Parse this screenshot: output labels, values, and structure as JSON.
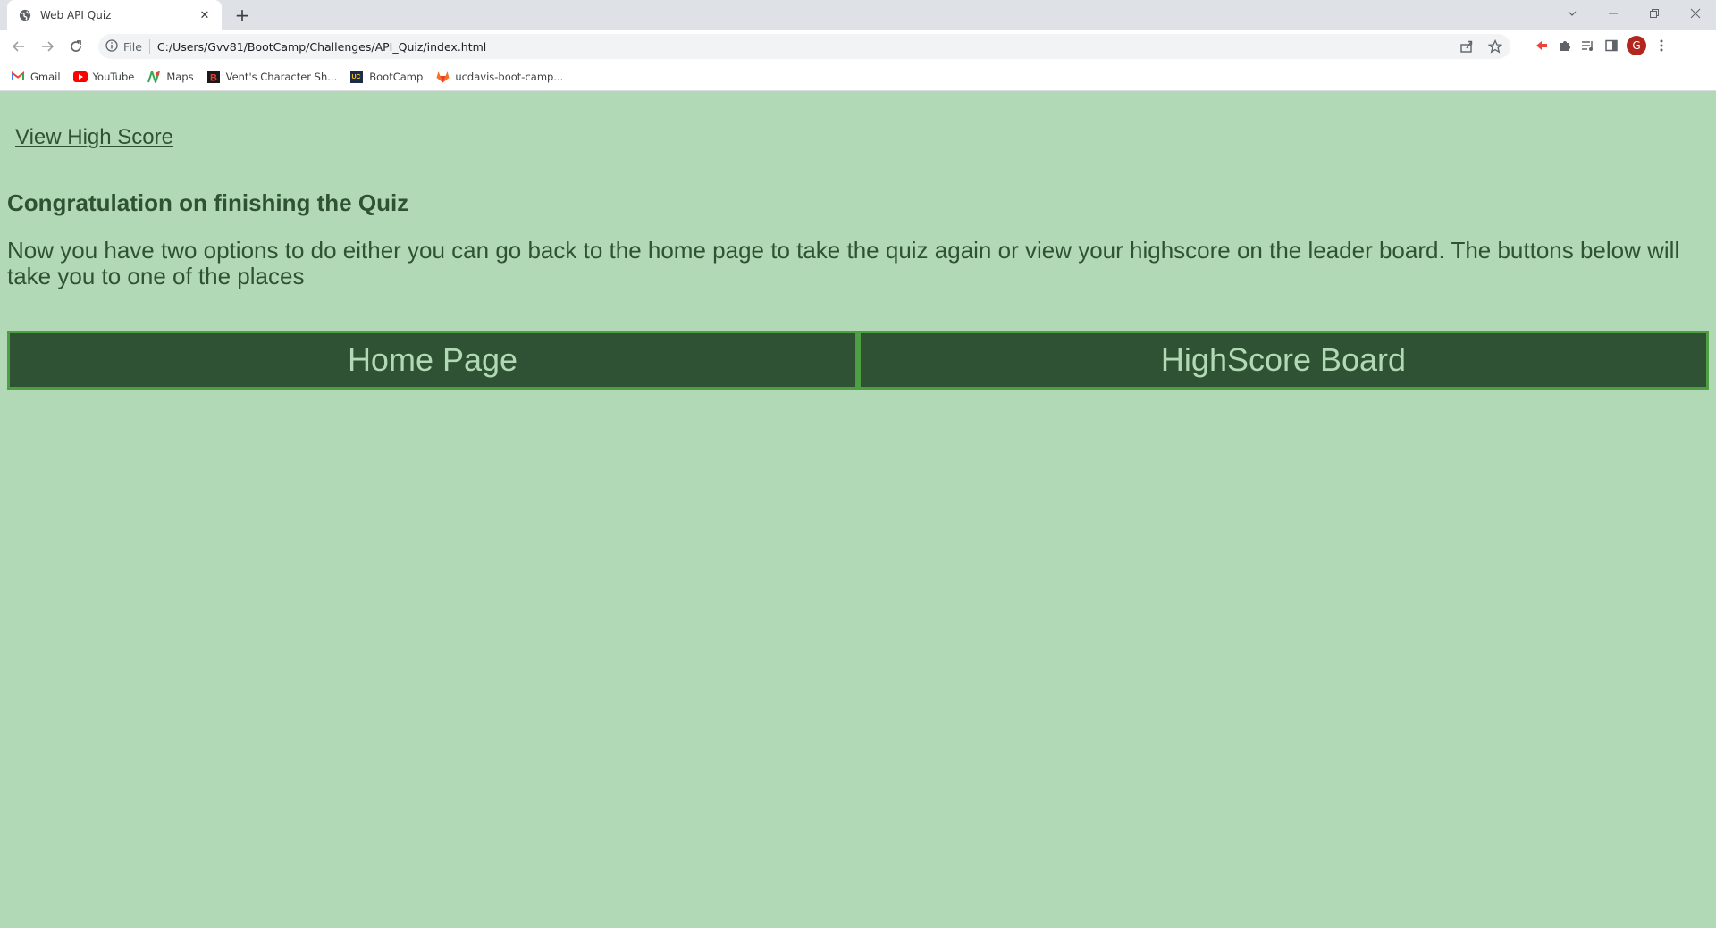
{
  "browser": {
    "tab_title": "Web API Quiz",
    "address_scheme": "File",
    "address_url": "C:/Users/Gvv81/BootCamp/Challenges/API_Quiz/index.html",
    "profile_initial": "G",
    "bookmarks": [
      {
        "label": "Gmail",
        "icon": "gmail-icon"
      },
      {
        "label": "YouTube",
        "icon": "youtube-icon"
      },
      {
        "label": "Maps",
        "icon": "maps-icon"
      },
      {
        "label": "Vent's Character Sh...",
        "icon": "vent-icon"
      },
      {
        "label": "BootCamp",
        "icon": "bootcamp-icon"
      },
      {
        "label": "ucdavis-boot-camp...",
        "icon": "gitlab-icon"
      }
    ]
  },
  "page": {
    "high_score_link": "View High Score",
    "heading": "Congratulation on finishing the Quiz",
    "message": "Now you have two options to do either you can go back to the home page to take the quiz again or view your highscore on the leader board. The buttons below will take you to one of the places",
    "home_button": "Home Page",
    "highscore_button": "HighScore Board"
  },
  "colors": {
    "page_background": "#b2d9b5",
    "text_dark_green": "#2e5233",
    "button_background": "#2e5233",
    "button_border": "#4e9f44",
    "button_text": "#b2d9b5",
    "profile_avatar": "#b3261e"
  }
}
